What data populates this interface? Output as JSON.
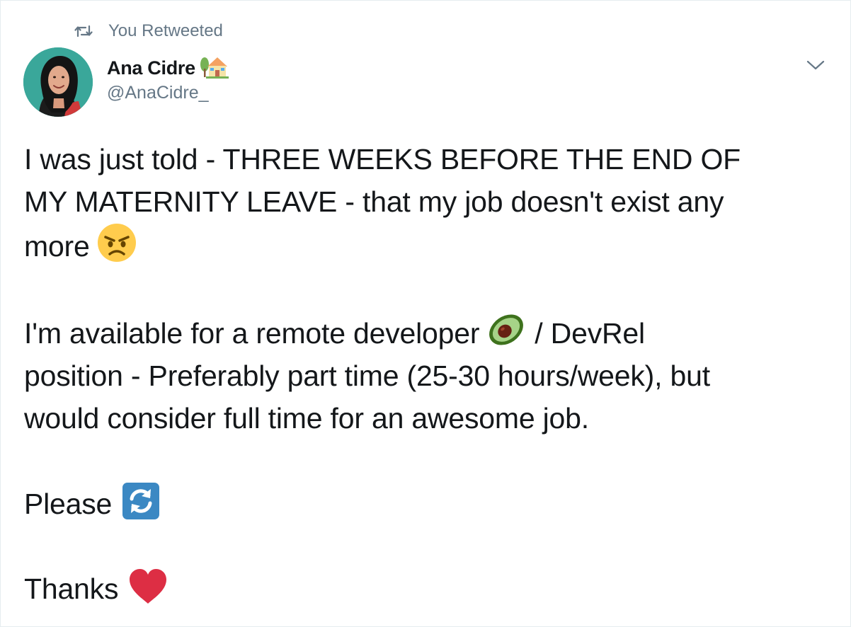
{
  "retweet_context": {
    "label": "You Retweeted",
    "icon": "retweet-icon"
  },
  "author": {
    "display_name": "Ana Cidre",
    "name_emoji": "house-with-garden-icon",
    "handle": "@AnaCidre_",
    "avatar": "avatar-photo"
  },
  "menu": {
    "icon": "chevron-down-icon"
  },
  "tweet": {
    "line1": "I was just told - THREE WEEKS BEFORE THE END OF",
    "line2": "MY MATERNITY LEAVE - that my job doesn't exist any",
    "line3": "more",
    "line3_emoji": "angry-face-icon",
    "line4": "I'm available for a remote developer",
    "line4_emoji": "avocado-icon",
    "line4_after": "/ DevRel",
    "line5": "position - Preferably part time (25-30 hours/week), but",
    "line6": "would consider full time for an awesome job.",
    "line7": "Please",
    "line7_emoji": "counterclockwise-arrows-icon",
    "line8": "Thanks",
    "line8_emoji": "red-heart-icon"
  },
  "colors": {
    "text": "#14171a",
    "secondary": "#657786",
    "border": "#e6ecf0"
  }
}
